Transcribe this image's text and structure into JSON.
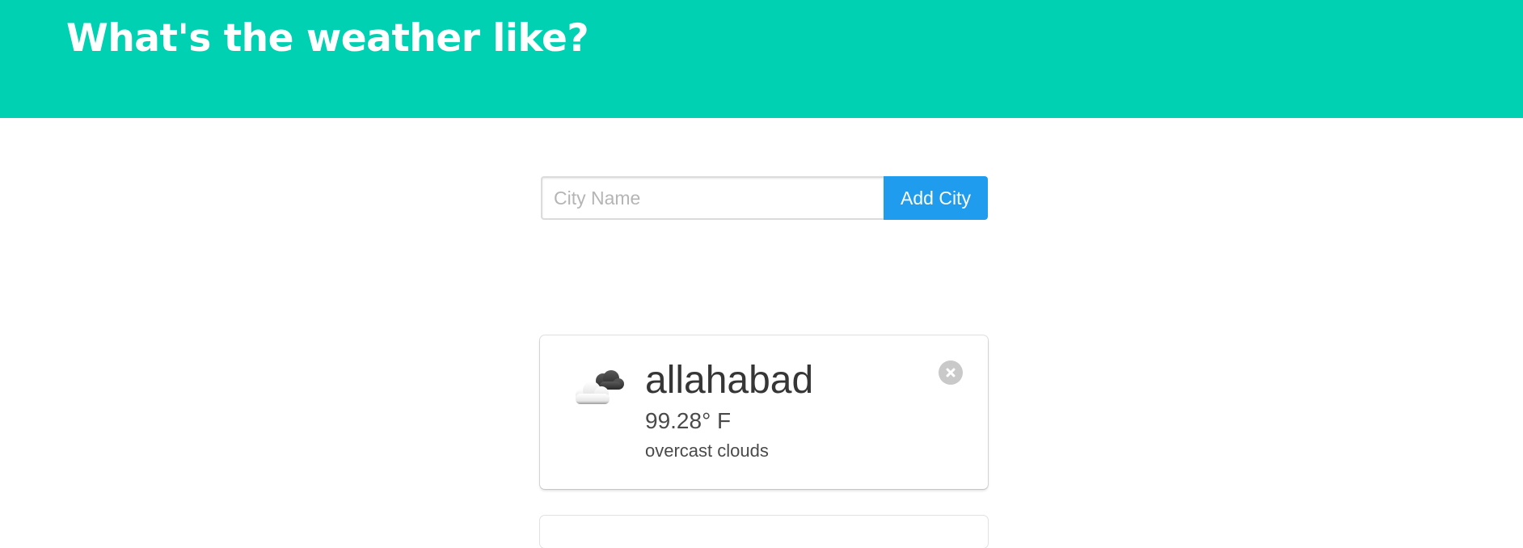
{
  "header": {
    "title": "What's the weather like?",
    "background_color": "#00d1b2"
  },
  "add_city": {
    "input_value": "",
    "placeholder": "City Name",
    "button_label": "Add City",
    "button_color": "#209cee"
  },
  "cities": [
    {
      "name": "allahabad",
      "temperature": "99.28° F",
      "description": "overcast clouds",
      "icon": "overcast-clouds-icon",
      "delete_icon": "close-icon"
    }
  ]
}
